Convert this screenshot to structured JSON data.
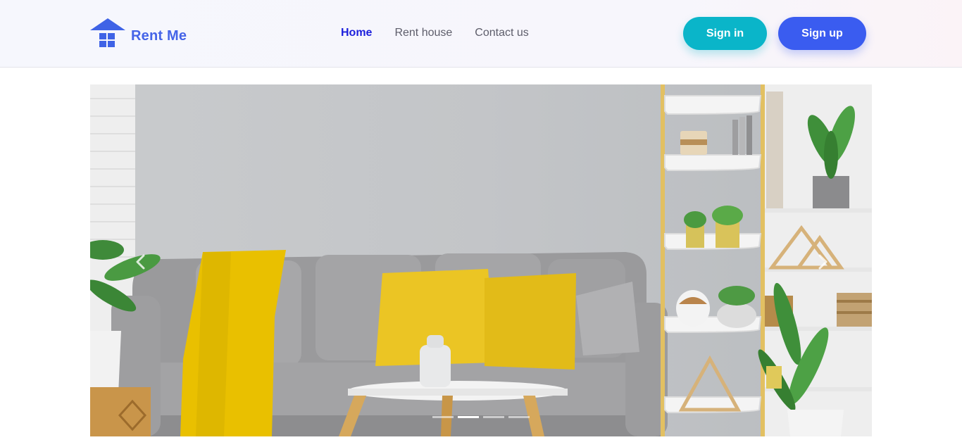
{
  "brand": {
    "name": "Rent Me",
    "icon": "house-icon",
    "color": "#4564e8"
  },
  "nav": {
    "items": [
      {
        "label": "Home",
        "active": true
      },
      {
        "label": "Rent house",
        "active": false
      },
      {
        "label": "Contact us",
        "active": false
      }
    ],
    "active_color": "#1c1fdc"
  },
  "auth": {
    "sign_in_label": "Sign in",
    "sign_up_label": "Sign up",
    "sign_in_color": "#0ab5c9",
    "sign_up_color": "#3a5cf0"
  },
  "carousel": {
    "prev_icon": "chevron-left-icon",
    "next_icon": "chevron-right-icon",
    "slide_count": 4,
    "active_slide": 2
  }
}
